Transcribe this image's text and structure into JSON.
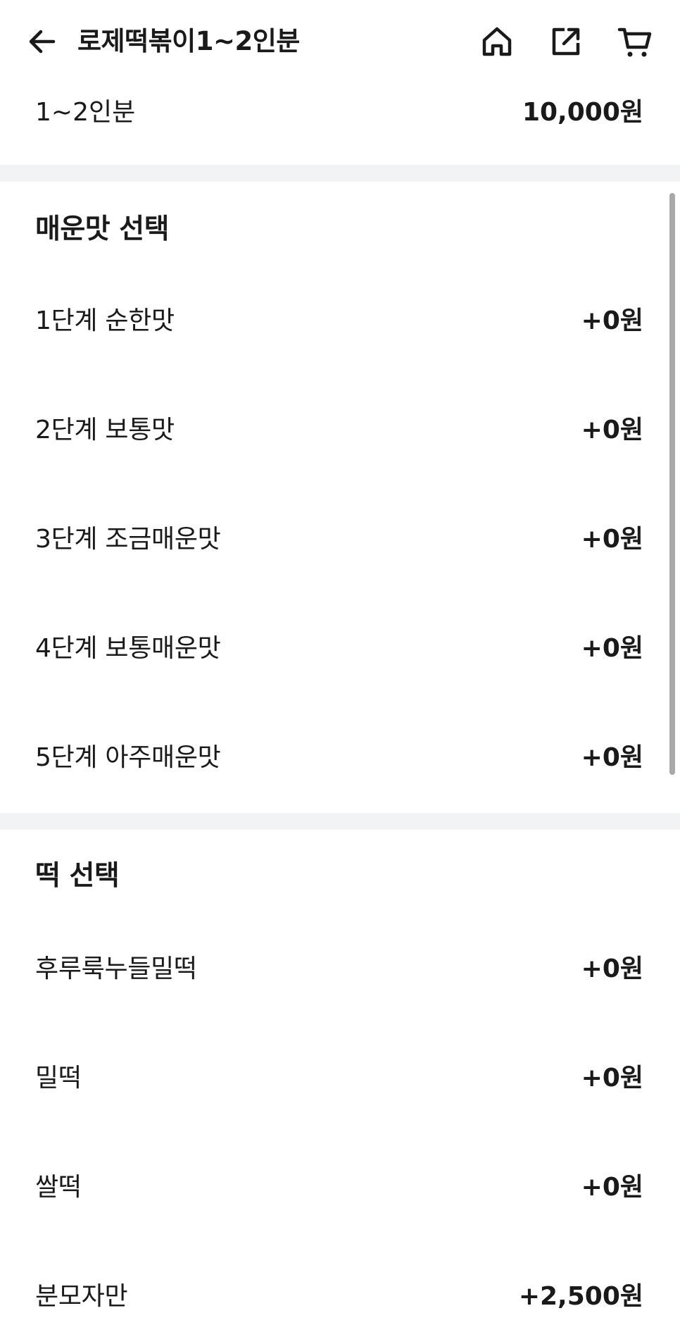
{
  "header": {
    "title": "로제떡볶이1~2인분",
    "back_icon": "arrow-left-icon",
    "home_icon": "home-icon",
    "share_icon": "share-icon",
    "cart_icon": "cart-icon"
  },
  "summary": {
    "label": "1~2인분",
    "price": "10,000원"
  },
  "spice_section": {
    "title": "매운맛 선택",
    "options": [
      {
        "label": "1단계 순한맛",
        "price": "+0원"
      },
      {
        "label": "2단계 보통맛",
        "price": "+0원"
      },
      {
        "label": "3단계 조금매운맛",
        "price": "+0원"
      },
      {
        "label": "4단계 보통매운맛",
        "price": "+0원"
      },
      {
        "label": "5단계 아주매운맛",
        "price": "+0원"
      }
    ]
  },
  "rice_cake_section": {
    "title": "떡 선택",
    "options": [
      {
        "label": "후루룩누들밀떡",
        "price": "+0원"
      },
      {
        "label": "밀떡",
        "price": "+0원"
      },
      {
        "label": "쌀떡",
        "price": "+0원"
      },
      {
        "label": "분모자만",
        "price": "+2,500원"
      }
    ]
  },
  "colors": {
    "text": "#1a1a1a",
    "divider": "#f2f3f5",
    "scrollbar": "#a9a9a9"
  }
}
